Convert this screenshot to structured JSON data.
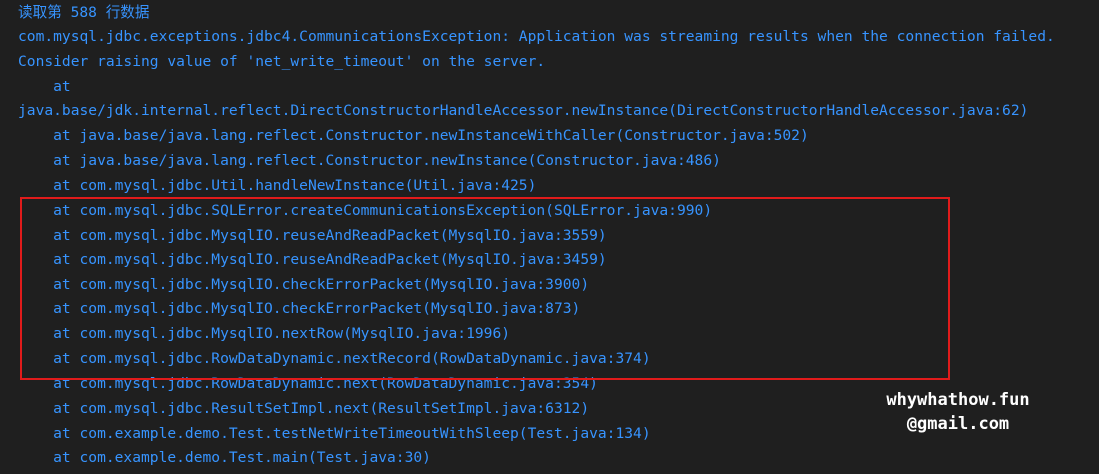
{
  "console": {
    "lines": [
      "读取第 588 行数据",
      "com.mysql.jdbc.exceptions.jdbc4.CommunicationsException: Application was streaming results when the connection failed.",
      "Consider raising value of 'net_write_timeout' on the server.",
      "    at",
      "java.base/jdk.internal.reflect.DirectConstructorHandleAccessor.newInstance(DirectConstructorHandleAccessor.java:62)",
      "    at java.base/java.lang.reflect.Constructor.newInstanceWithCaller(Constructor.java:502)",
      "    at java.base/java.lang.reflect.Constructor.newInstance(Constructor.java:486)",
      "    at com.mysql.jdbc.Util.handleNewInstance(Util.java:425)",
      "    at com.mysql.jdbc.SQLError.createCommunicationsException(SQLError.java:990)",
      "    at com.mysql.jdbc.MysqlIO.reuseAndReadPacket(MysqlIO.java:3559)",
      "    at com.mysql.jdbc.MysqlIO.reuseAndReadPacket(MysqlIO.java:3459)",
      "    at com.mysql.jdbc.MysqlIO.checkErrorPacket(MysqlIO.java:3900)",
      "    at com.mysql.jdbc.MysqlIO.checkErrorPacket(MysqlIO.java:873)",
      "    at com.mysql.jdbc.MysqlIO.nextRow(MysqlIO.java:1996)",
      "    at com.mysql.jdbc.RowDataDynamic.nextRecord(RowDataDynamic.java:374)",
      "    at com.mysql.jdbc.RowDataDynamic.next(RowDataDynamic.java:354)",
      "    at com.mysql.jdbc.ResultSetImpl.next(ResultSetImpl.java:6312)",
      "    at com.example.demo.Test.testNetWriteTimeoutWithSleep(Test.java:134)",
      "    at com.example.demo.Test.main(Test.java:30)"
    ],
    "highlighted_lines": [
      "    at com.mysql.jdbc.SQLError.createCommunicationsException(SQLError.java:990)",
      "    at com.mysql.jdbc.MysqlIO.reuseAndReadPacket(MysqlIO.java:3559)",
      "    at com.mysql.jdbc.MysqlIO.reuseAndReadPacket(MysqlIO.java:3459)",
      "    at com.mysql.jdbc.MysqlIO.checkErrorPacket(MysqlIO.java:3900)",
      "    at com.mysql.jdbc.MysqlIO.checkErrorPacket(MysqlIO.java:873)",
      "    at com.mysql.jdbc.MysqlIO.nextRow(MysqlIO.java:1996)",
      "    at com.mysql.jdbc.RowDataDynamic.nextRecord(RowDataDynamic.java:374)"
    ]
  },
  "watermark": {
    "line1": "whywhathow.fun",
    "line2": "@gmail.com"
  },
  "colors": {
    "background": "#1f1f1f",
    "text": "#3794ff",
    "highlight_border": "#e01b1b",
    "watermark": "#ffffff"
  }
}
